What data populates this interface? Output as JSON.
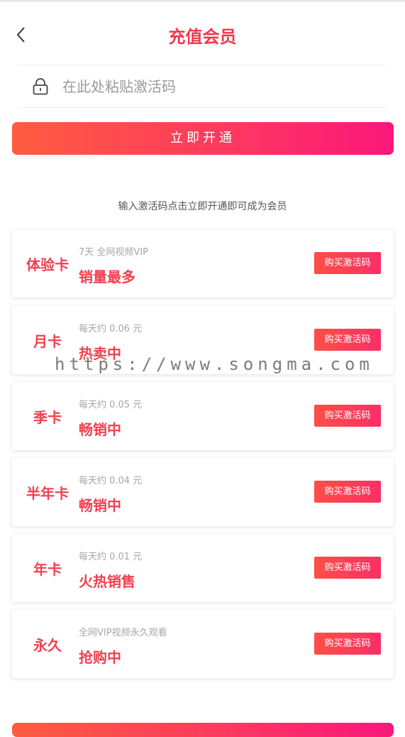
{
  "header": {
    "title": "充值会员",
    "back_icon": "chevron-left-icon"
  },
  "activation": {
    "lock_icon": "lock-icon",
    "placeholder": "在此处粘贴激活码",
    "value": "",
    "button_label": "立即开通",
    "hint": "输入激活码点击立即开通即可成为会员"
  },
  "plans": [
    {
      "name": "体验卡",
      "desc": "7天 全网视频VIP",
      "tag": "销量最多",
      "buy_label": "购买激活码"
    },
    {
      "name": "月卡",
      "desc": "每天约 0.06 元",
      "tag": "热卖中",
      "buy_label": "购买激活码"
    },
    {
      "name": "季卡",
      "desc": "每天约 0.05 元",
      "tag": "畅销中",
      "buy_label": "购买激活码"
    },
    {
      "name": "半年卡",
      "desc": "每天约 0.04 元",
      "tag": "畅销中",
      "buy_label": "购买激活码"
    },
    {
      "name": "年卡",
      "desc": "每天约 0.01 元",
      "tag": "火热销售",
      "buy_label": "购买激活码"
    },
    {
      "name": "永久",
      "desc": "全网VIP视频永久观看",
      "tag": "抢购中",
      "buy_label": "购买激活码"
    }
  ],
  "watermark": "https://www.songma.com",
  "colors": {
    "accent": "#f2404f",
    "gradient_start": "#fe5c3f",
    "gradient_end": "#fb177b"
  }
}
